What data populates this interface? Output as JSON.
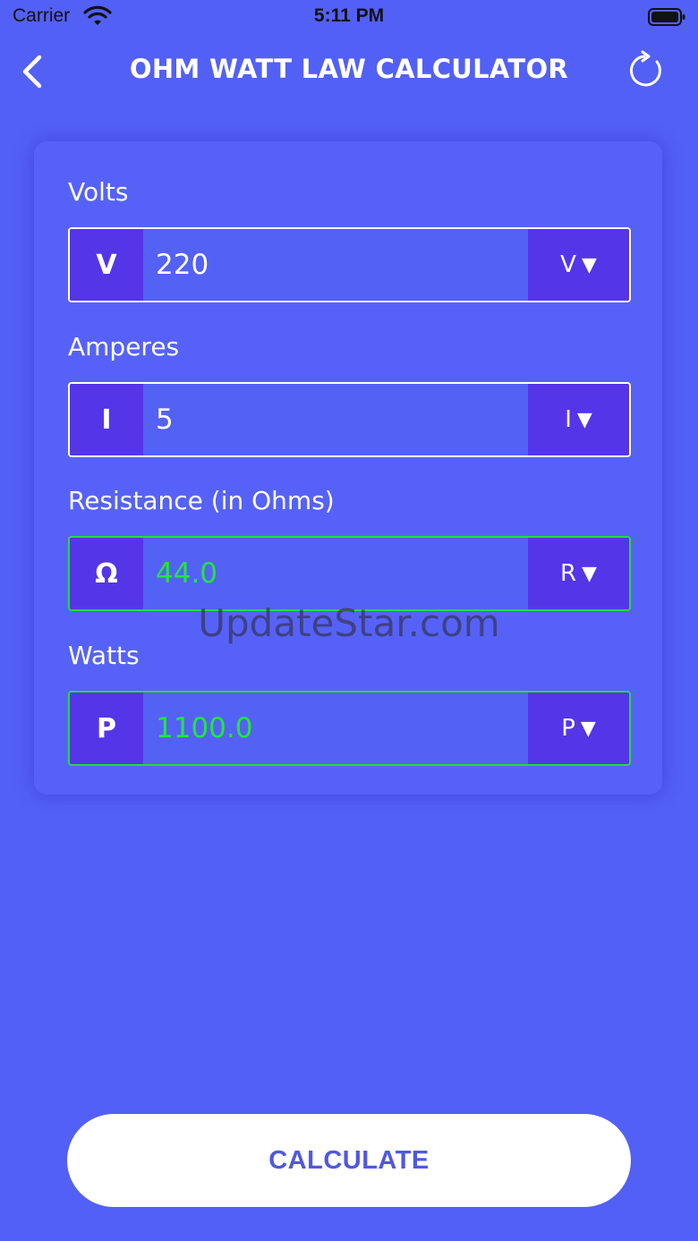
{
  "status_bar": {
    "carrier": "Carrier",
    "time": "5:11 PM"
  },
  "nav": {
    "title": "OHM WATT LAW CALCULATOR",
    "back_icon": "chevron-left-icon",
    "refresh_icon": "refresh-icon"
  },
  "fields": [
    {
      "label": "Volts",
      "prefix": "V",
      "value": "220",
      "unit": "V",
      "state": "input"
    },
    {
      "label": "Amperes",
      "prefix": "I",
      "value": "5",
      "unit": "I",
      "state": "input"
    },
    {
      "label": "Resistance (in Ohms)",
      "prefix": "Ω",
      "value": "44.0",
      "unit": "R",
      "state": "result"
    },
    {
      "label": "Watts",
      "prefix": "P",
      "value": "1100.0",
      "unit": "P",
      "state": "result"
    }
  ],
  "caret": "▼",
  "watermark": "UpdateStar.com",
  "calculate_label": "CALCULATE",
  "colors": {
    "background": "#5360f5",
    "prefix_bg": "#5535e8",
    "result_green": "#22e63f",
    "button_text": "#5058e0"
  }
}
